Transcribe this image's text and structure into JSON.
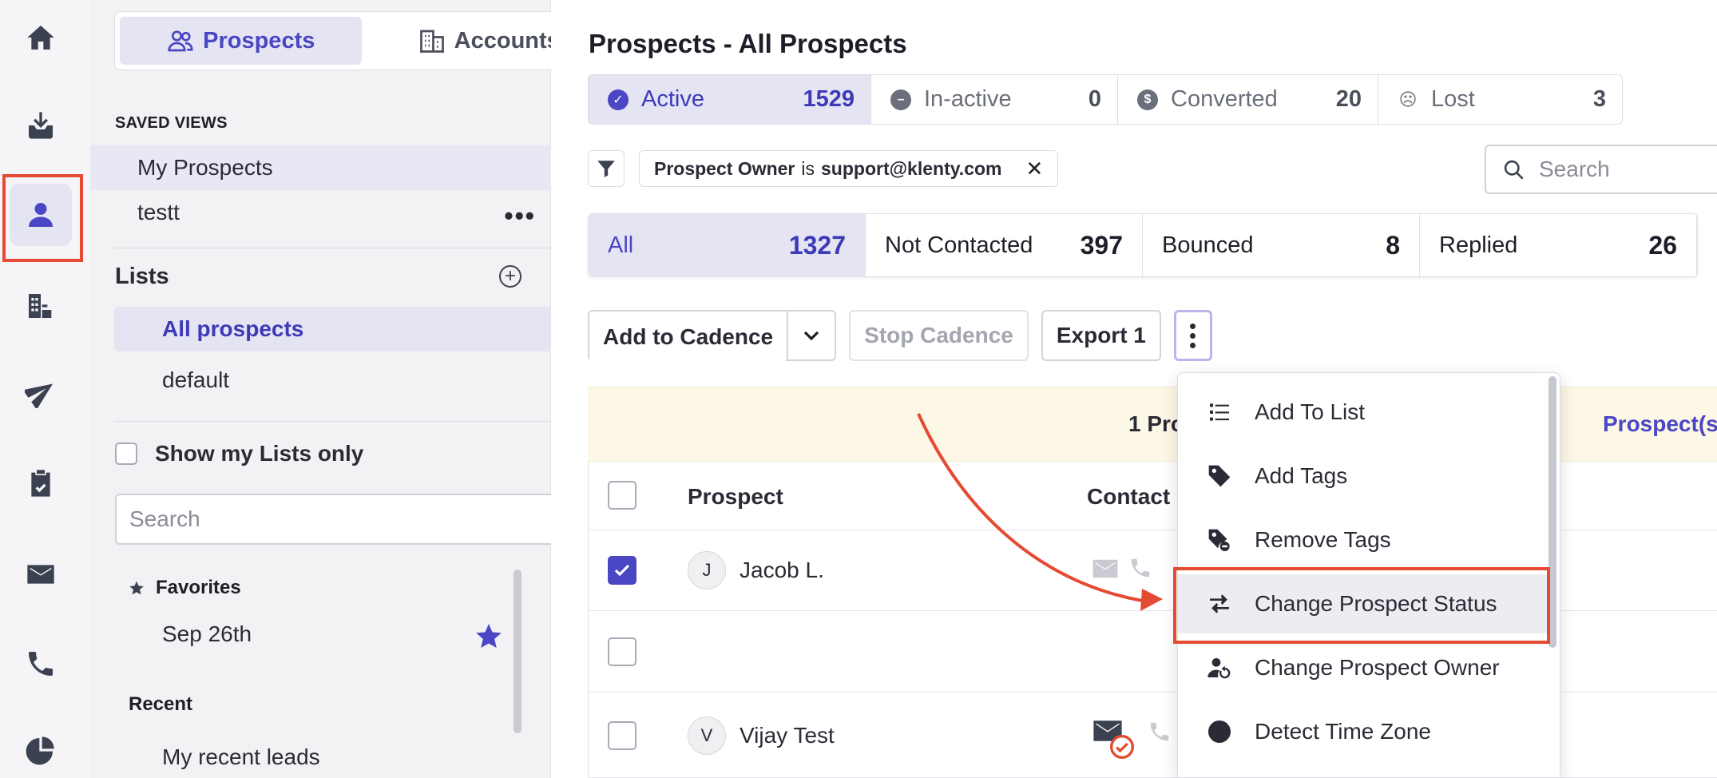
{
  "nav": {
    "items": [
      {
        "name": "home-icon"
      },
      {
        "name": "inbox-icon"
      },
      {
        "name": "prospects-icon",
        "active": true
      },
      {
        "name": "accounts-icon"
      },
      {
        "name": "send-icon"
      },
      {
        "name": "tasks-icon"
      },
      {
        "name": "mail-icon"
      },
      {
        "name": "phone-icon"
      },
      {
        "name": "reports-icon"
      }
    ]
  },
  "sidebar": {
    "toggle": {
      "prospects": "Prospects",
      "accounts": "Accounts"
    },
    "saved_views_title": "SAVED VIEWS",
    "saved_views": [
      "My Prospects",
      "testt"
    ],
    "lists_title": "Lists",
    "lists": [
      "All prospects",
      "default"
    ],
    "show_my_lists": "Show my Lists only",
    "search_placeholder": "Search",
    "favorites_title": "Favorites",
    "favorites": [
      "Sep 26th"
    ],
    "recent_title": "Recent",
    "recent": [
      "My recent leads"
    ]
  },
  "main": {
    "title": "Prospects - All Prospects",
    "status_tabs": [
      {
        "label": "Active",
        "count": "1529"
      },
      {
        "label": "In-active",
        "count": "0"
      },
      {
        "label": "Converted",
        "count": "20"
      },
      {
        "label": "Lost",
        "count": "3"
      }
    ],
    "filter": {
      "field": "Prospect Owner",
      "op": "is",
      "value": "support@klenty.com"
    },
    "search_placeholder": "Search",
    "sub_tabs": [
      {
        "label": "All",
        "count": "1327"
      },
      {
        "label": "Not Contacted",
        "count": "397"
      },
      {
        "label": "Bounced",
        "count": "8"
      },
      {
        "label": "Replied",
        "count": "26"
      }
    ],
    "actions": {
      "add_to_cadence": "Add to Cadence",
      "stop_cadence": "Stop Cadence",
      "export": "Export 1"
    },
    "banner": {
      "text": "1 Pro",
      "link": "Prospect(s)"
    },
    "table": {
      "headers": {
        "prospect": "Prospect",
        "contact": "Contact"
      },
      "rows": [
        {
          "initial": "J",
          "name": "Jacob L.",
          "checked": true
        },
        {
          "initial": "",
          "name": "",
          "checked": false
        },
        {
          "initial": "V",
          "name": "Vijay Test",
          "checked": false
        }
      ]
    }
  },
  "menu": {
    "items": [
      {
        "label": "Add To List",
        "icon": "list-icon"
      },
      {
        "label": "Add Tags",
        "icon": "tag-icon"
      },
      {
        "label": "Remove Tags",
        "icon": "tag-remove-icon"
      },
      {
        "label": "Change Prospect Status",
        "icon": "swap-icon",
        "highlighted": true
      },
      {
        "label": "Change Prospect Owner",
        "icon": "user-refresh-icon"
      },
      {
        "label": "Detect Time Zone",
        "icon": "clock-icon"
      }
    ]
  },
  "colors": {
    "accent": "#4a46c4",
    "annotation": "#e54a32",
    "banner": "#fdf7e6"
  }
}
